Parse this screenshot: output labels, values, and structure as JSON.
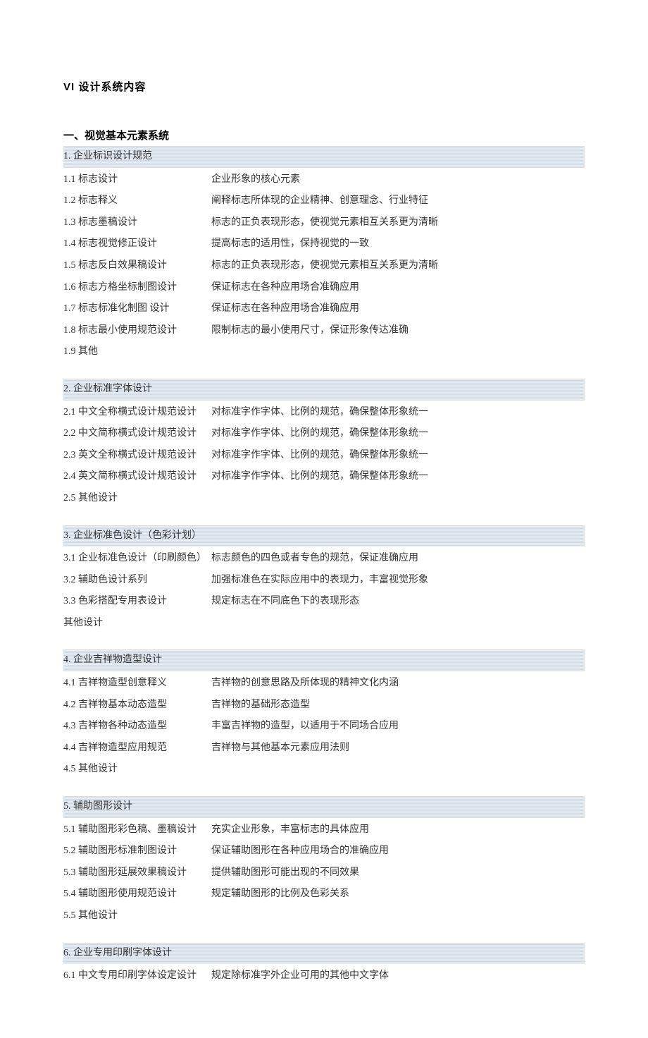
{
  "title": "VI 设计系统内容",
  "section1_title": "一、视觉基本元素系统",
  "groups": [
    {
      "header": "1. 企业标识设计规范",
      "first": true,
      "rows": [
        {
          "left": "1.1 标志设计",
          "right": "企业形象的核心元素"
        },
        {
          "left": "1.2 标志释义",
          "right": "阐释标志所体现的企业精神、创意理念、行业特征"
        },
        {
          "left": "1.3 标志墨稿设计",
          "right": "标志的正负表现形态，使视觉元素相互关系更为清晰"
        },
        {
          "left": "1.4 标志视觉修正设计",
          "right": "提高标志的适用性，保持视觉的一致"
        },
        {
          "left": "1.5 标志反白效果稿设计",
          "right": "标志的正负表现形态，使视觉元素相互关系更为清晰"
        },
        {
          "left": "1.6 标志方格坐标制图设计",
          "right": "保证标志在各种应用场合准确应用"
        },
        {
          "left": "1.7 标志标准化制图  设计",
          "right": "保证标志在各种应用场合准确应用"
        },
        {
          "left": "1.8 标志最小使用规范设计",
          "right": "限制标志的最小使用尺寸，保证形象传达准确"
        },
        {
          "left": "1.9 其他",
          "right": ""
        }
      ]
    },
    {
      "header": "2. 企业标准字体设计",
      "rows": [
        {
          "left": "2.1 中文全称横式设计规范设计",
          "right": "对标准字作字体、比例的规范，确保整体形象统一"
        },
        {
          "left": "2.2 中文简称横式设计规范设计",
          "right": "对标准字作字体、比例的规范，确保整体形象统一"
        },
        {
          "left": "2.3 英文全称横式设计规范设计",
          "right": "对标准字作字体、比例的规范，确保整体形象统一"
        },
        {
          "left": "2.4 英文简称横式设计规范设计",
          "right": "对标准字作字体、比例的规范，确保整体形象统一"
        },
        {
          "left": "2.5 其他设计",
          "right": ""
        }
      ]
    },
    {
      "header": "3. 企业标准色设计（色彩计划）",
      "rows": [
        {
          "left": "3.1 企业标准色设计（印刷颜色）",
          "right": "标志颜色的四色或者专色的规范，保证准确应用"
        },
        {
          "left": "3.2 辅助色设计系列",
          "right": "加强标准色在实际应用中的表现力，丰富视觉形象"
        },
        {
          "left": "3.3 色彩搭配专用表设计",
          "right": "规定标志在不同底色下的表现形态"
        },
        {
          "left": "其他设计",
          "right": ""
        }
      ]
    },
    {
      "header": "4. 企业吉祥物造型设计",
      "rows": [
        {
          "left": "4.1 吉祥物造型创意释义",
          "right": "吉祥物的创意思路及所体现的精神文化内涵"
        },
        {
          "left": "4.2 吉祥物基本动态造型",
          "right": "吉祥物的基础形态造型"
        },
        {
          "left": "4.3 吉祥物各种动态造型",
          "right": "丰富吉祥物的造型，以适用于不同场合应用"
        },
        {
          "left": "4.4 吉祥物造型应用规范",
          "right": "吉祥物与其他基本元素应用法则"
        },
        {
          "left": "4.5 其他设计",
          "right": ""
        }
      ]
    },
    {
      "header": "5. 辅助图形设计",
      "rows": [
        {
          "left": "5.1 辅助图形彩色稿、墨稿设计",
          "right": "充实企业形象，丰富标志的具体应用"
        },
        {
          "left": "5.2 辅助图形标准制图设计",
          "right": "保证辅助图形在各种应用场合的准确应用"
        },
        {
          "left": "5.3 辅助图形延展效果稿设计",
          "right": "提供辅助图形可能出现的不同效果"
        },
        {
          "left": "5.4 辅助图形使用规范设计",
          "right": "规定辅助图形的比例及色彩关系"
        },
        {
          "left": "5.5 其他设计",
          "right": ""
        }
      ]
    },
    {
      "header": "6. 企业专用印刷字体设计",
      "rows": [
        {
          "left": "6.1 中文专用印刷字体设定设计",
          "right": "规定除标准字外企业可用的其他中文字体"
        }
      ]
    }
  ]
}
